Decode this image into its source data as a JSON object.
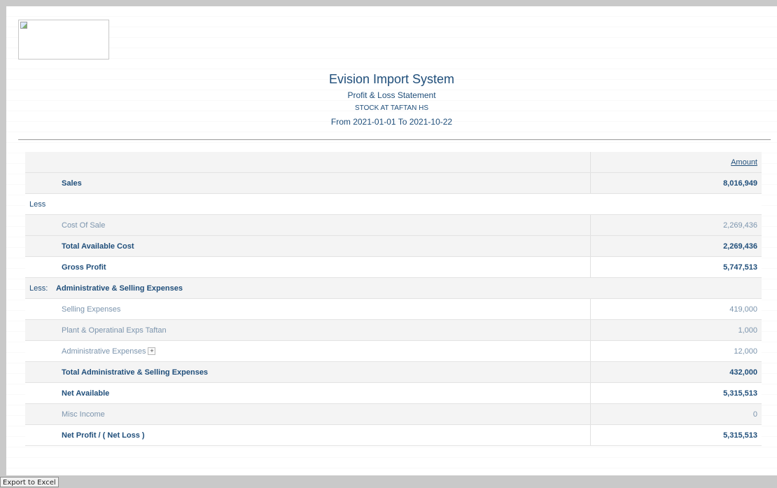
{
  "header": {
    "app_title": "Evision Import System",
    "report_title": "Profit & Loss Statement",
    "location": "STOCK AT TAFTAN HS",
    "date_range": "From 2021-01-01 To 2021-10-22"
  },
  "table": {
    "amount_header": "Amount",
    "sales": {
      "label": "Sales",
      "amount": "8,016,949"
    },
    "less_label": "Less",
    "cost_of_sale": {
      "label": "Cost Of Sale",
      "amount": "2,269,436"
    },
    "total_available_cost": {
      "label": "Total Available Cost",
      "amount": "2,269,436"
    },
    "gross_profit": {
      "label": "Gross Profit",
      "amount": "5,747,513"
    },
    "expenses_section": {
      "prefix": "Less:",
      "label": "Administrative & Selling Expenses"
    },
    "selling_expenses": {
      "label": "Selling Expenses",
      "amount": "419,000"
    },
    "plant_expenses": {
      "label": "Plant & Operatinal Exps Taftan",
      "amount": "1,000"
    },
    "admin_expenses": {
      "label": "Administrative Expenses",
      "amount": "12,000",
      "expand_symbol": "+"
    },
    "total_admin_selling": {
      "label": "Total Administrative & Selling Expenses",
      "amount": "432,000"
    },
    "net_available": {
      "label": "Net Available",
      "amount": "5,315,513"
    },
    "misc_income": {
      "label": "Misc Income",
      "amount": "0"
    },
    "net_profit": {
      "label": "Net Profit / ( Net Loss )",
      "amount": "5,315,513"
    }
  },
  "export_button_label": "Export to Excel",
  "colors": {
    "text_blue": "#1f4e7a",
    "muted_blue": "#7b94ad",
    "row_shade": "#f4f4f4"
  }
}
